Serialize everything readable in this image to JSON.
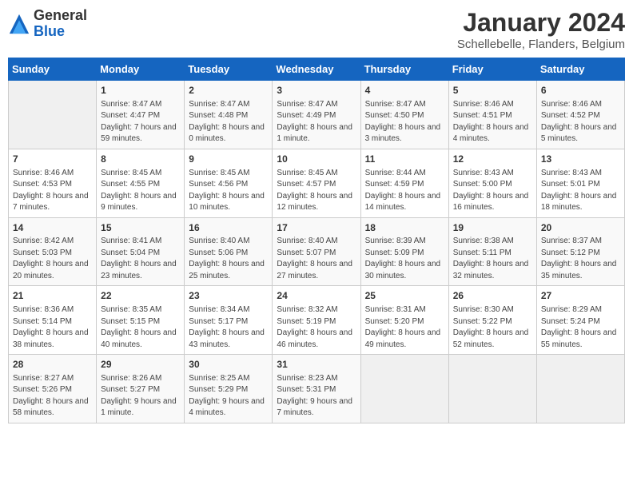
{
  "header": {
    "logo": {
      "general": "General",
      "blue": "Blue"
    },
    "title": "January 2024",
    "subtitle": "Schellebelle, Flanders, Belgium"
  },
  "days_of_week": [
    "Sunday",
    "Monday",
    "Tuesday",
    "Wednesday",
    "Thursday",
    "Friday",
    "Saturday"
  ],
  "weeks": [
    [
      {
        "day": "",
        "sunrise": "",
        "sunset": "",
        "daylight": ""
      },
      {
        "day": "1",
        "sunrise": "Sunrise: 8:47 AM",
        "sunset": "Sunset: 4:47 PM",
        "daylight": "Daylight: 7 hours and 59 minutes."
      },
      {
        "day": "2",
        "sunrise": "Sunrise: 8:47 AM",
        "sunset": "Sunset: 4:48 PM",
        "daylight": "Daylight: 8 hours and 0 minutes."
      },
      {
        "day": "3",
        "sunrise": "Sunrise: 8:47 AM",
        "sunset": "Sunset: 4:49 PM",
        "daylight": "Daylight: 8 hours and 1 minute."
      },
      {
        "day": "4",
        "sunrise": "Sunrise: 8:47 AM",
        "sunset": "Sunset: 4:50 PM",
        "daylight": "Daylight: 8 hours and 3 minutes."
      },
      {
        "day": "5",
        "sunrise": "Sunrise: 8:46 AM",
        "sunset": "Sunset: 4:51 PM",
        "daylight": "Daylight: 8 hours and 4 minutes."
      },
      {
        "day": "6",
        "sunrise": "Sunrise: 8:46 AM",
        "sunset": "Sunset: 4:52 PM",
        "daylight": "Daylight: 8 hours and 5 minutes."
      }
    ],
    [
      {
        "day": "7",
        "sunrise": "Sunrise: 8:46 AM",
        "sunset": "Sunset: 4:53 PM",
        "daylight": "Daylight: 8 hours and 7 minutes."
      },
      {
        "day": "8",
        "sunrise": "Sunrise: 8:45 AM",
        "sunset": "Sunset: 4:55 PM",
        "daylight": "Daylight: 8 hours and 9 minutes."
      },
      {
        "day": "9",
        "sunrise": "Sunrise: 8:45 AM",
        "sunset": "Sunset: 4:56 PM",
        "daylight": "Daylight: 8 hours and 10 minutes."
      },
      {
        "day": "10",
        "sunrise": "Sunrise: 8:45 AM",
        "sunset": "Sunset: 4:57 PM",
        "daylight": "Daylight: 8 hours and 12 minutes."
      },
      {
        "day": "11",
        "sunrise": "Sunrise: 8:44 AM",
        "sunset": "Sunset: 4:59 PM",
        "daylight": "Daylight: 8 hours and 14 minutes."
      },
      {
        "day": "12",
        "sunrise": "Sunrise: 8:43 AM",
        "sunset": "Sunset: 5:00 PM",
        "daylight": "Daylight: 8 hours and 16 minutes."
      },
      {
        "day": "13",
        "sunrise": "Sunrise: 8:43 AM",
        "sunset": "Sunset: 5:01 PM",
        "daylight": "Daylight: 8 hours and 18 minutes."
      }
    ],
    [
      {
        "day": "14",
        "sunrise": "Sunrise: 8:42 AM",
        "sunset": "Sunset: 5:03 PM",
        "daylight": "Daylight: 8 hours and 20 minutes."
      },
      {
        "day": "15",
        "sunrise": "Sunrise: 8:41 AM",
        "sunset": "Sunset: 5:04 PM",
        "daylight": "Daylight: 8 hours and 23 minutes."
      },
      {
        "day": "16",
        "sunrise": "Sunrise: 8:40 AM",
        "sunset": "Sunset: 5:06 PM",
        "daylight": "Daylight: 8 hours and 25 minutes."
      },
      {
        "day": "17",
        "sunrise": "Sunrise: 8:40 AM",
        "sunset": "Sunset: 5:07 PM",
        "daylight": "Daylight: 8 hours and 27 minutes."
      },
      {
        "day": "18",
        "sunrise": "Sunrise: 8:39 AM",
        "sunset": "Sunset: 5:09 PM",
        "daylight": "Daylight: 8 hours and 30 minutes."
      },
      {
        "day": "19",
        "sunrise": "Sunrise: 8:38 AM",
        "sunset": "Sunset: 5:11 PM",
        "daylight": "Daylight: 8 hours and 32 minutes."
      },
      {
        "day": "20",
        "sunrise": "Sunrise: 8:37 AM",
        "sunset": "Sunset: 5:12 PM",
        "daylight": "Daylight: 8 hours and 35 minutes."
      }
    ],
    [
      {
        "day": "21",
        "sunrise": "Sunrise: 8:36 AM",
        "sunset": "Sunset: 5:14 PM",
        "daylight": "Daylight: 8 hours and 38 minutes."
      },
      {
        "day": "22",
        "sunrise": "Sunrise: 8:35 AM",
        "sunset": "Sunset: 5:15 PM",
        "daylight": "Daylight: 8 hours and 40 minutes."
      },
      {
        "day": "23",
        "sunrise": "Sunrise: 8:34 AM",
        "sunset": "Sunset: 5:17 PM",
        "daylight": "Daylight: 8 hours and 43 minutes."
      },
      {
        "day": "24",
        "sunrise": "Sunrise: 8:32 AM",
        "sunset": "Sunset: 5:19 PM",
        "daylight": "Daylight: 8 hours and 46 minutes."
      },
      {
        "day": "25",
        "sunrise": "Sunrise: 8:31 AM",
        "sunset": "Sunset: 5:20 PM",
        "daylight": "Daylight: 8 hours and 49 minutes."
      },
      {
        "day": "26",
        "sunrise": "Sunrise: 8:30 AM",
        "sunset": "Sunset: 5:22 PM",
        "daylight": "Daylight: 8 hours and 52 minutes."
      },
      {
        "day": "27",
        "sunrise": "Sunrise: 8:29 AM",
        "sunset": "Sunset: 5:24 PM",
        "daylight": "Daylight: 8 hours and 55 minutes."
      }
    ],
    [
      {
        "day": "28",
        "sunrise": "Sunrise: 8:27 AM",
        "sunset": "Sunset: 5:26 PM",
        "daylight": "Daylight: 8 hours and 58 minutes."
      },
      {
        "day": "29",
        "sunrise": "Sunrise: 8:26 AM",
        "sunset": "Sunset: 5:27 PM",
        "daylight": "Daylight: 9 hours and 1 minute."
      },
      {
        "day": "30",
        "sunrise": "Sunrise: 8:25 AM",
        "sunset": "Sunset: 5:29 PM",
        "daylight": "Daylight: 9 hours and 4 minutes."
      },
      {
        "day": "31",
        "sunrise": "Sunrise: 8:23 AM",
        "sunset": "Sunset: 5:31 PM",
        "daylight": "Daylight: 9 hours and 7 minutes."
      },
      {
        "day": "",
        "sunrise": "",
        "sunset": "",
        "daylight": ""
      },
      {
        "day": "",
        "sunrise": "",
        "sunset": "",
        "daylight": ""
      },
      {
        "day": "",
        "sunrise": "",
        "sunset": "",
        "daylight": ""
      }
    ]
  ]
}
